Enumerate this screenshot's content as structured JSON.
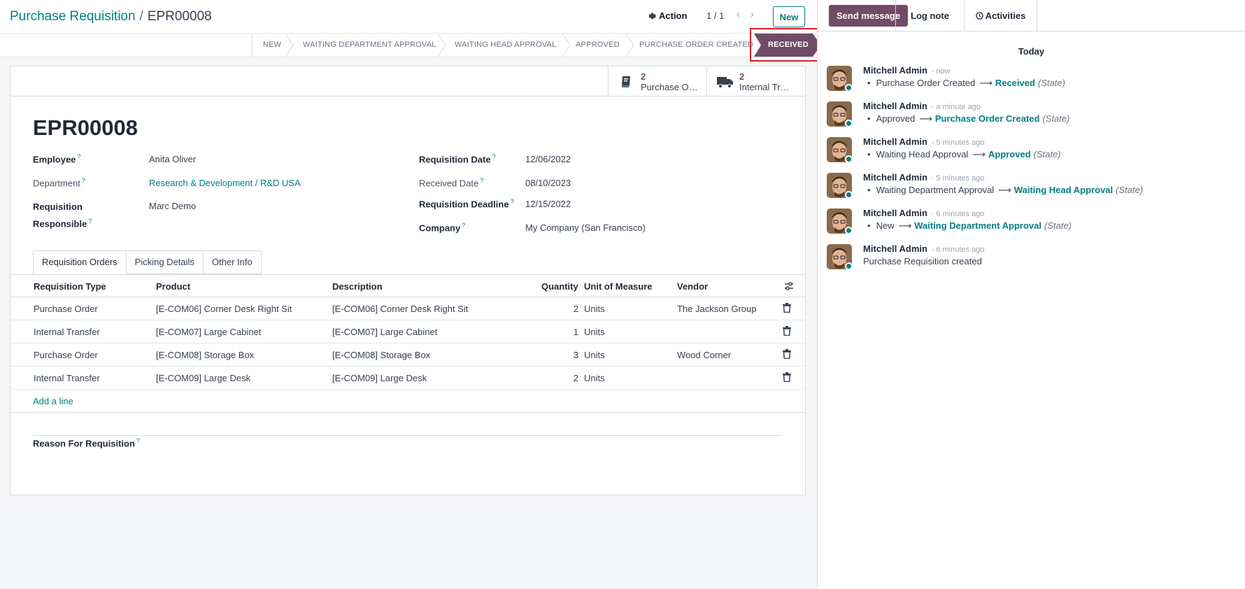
{
  "breadcrumb": {
    "parent": "Purchase Requisition",
    "current": "EPR00008"
  },
  "control": {
    "action_label": "Action",
    "pager": "1 / 1",
    "new_label": "New"
  },
  "statusbar": {
    "steps": [
      "NEW",
      "WAITING DEPARTMENT APPROVAL",
      "WAITING HEAD APPROVAL",
      "APPROVED",
      "PURCHASE ORDER CREATED",
      "RECEIVED"
    ],
    "active": "RECEIVED"
  },
  "smart_buttons": [
    {
      "count": "2",
      "label": "Purchase O…",
      "icon": "book-icon"
    },
    {
      "count": "2",
      "label": "Internal Tr…",
      "icon": "truck-icon"
    }
  ],
  "record": {
    "title": "EPR00008",
    "employee_label": "Employee",
    "employee": "Anita Oliver",
    "department_label": "Department",
    "department": "Research & Development / R&D USA",
    "responsible_label_1": "Requisition",
    "responsible_label_2": "Responsible",
    "responsible": "Marc Demo",
    "req_date_label": "Requisition Date",
    "req_date": "12/06/2022",
    "received_date_label": "Received Date",
    "received_date": "08/10/2023",
    "deadline_label": "Requisition Deadline",
    "deadline": "12/15/2022",
    "company_label": "Company",
    "company": "My Company (San Francisco)",
    "help_mark": "?"
  },
  "tabs": [
    "Requisition Orders",
    "Picking Details",
    "Other Info"
  ],
  "table": {
    "headers": [
      "Requisition Type",
      "Product",
      "Description",
      "Quantity",
      "Unit of Measure",
      "Vendor"
    ],
    "rows": [
      {
        "type": "Purchase Order",
        "product": "[E-COM06] Corner Desk Right Sit",
        "description": "[E-COM06] Corner Desk Right Sit",
        "qty": "2",
        "uom": "Units",
        "vendor": "The Jackson Group"
      },
      {
        "type": "Internal Transfer",
        "product": "[E-COM07] Large Cabinet",
        "description": "[E-COM07] Large Cabinet",
        "qty": "1",
        "uom": "Units",
        "vendor": ""
      },
      {
        "type": "Purchase Order",
        "product": "[E-COM08] Storage Box",
        "description": "[E-COM08] Storage Box",
        "qty": "3",
        "uom": "Units",
        "vendor": "Wood Corner"
      },
      {
        "type": "Internal Transfer",
        "product": "[E-COM09] Large Desk",
        "description": "[E-COM09] Large Desk",
        "qty": "2",
        "uom": "Units",
        "vendor": ""
      }
    ],
    "add_line": "Add a line"
  },
  "reason_label": "Reason For Requisition",
  "chatter": {
    "send_message": "Send message",
    "log_note": "Log note",
    "activities": "Activities",
    "today": "Today",
    "messages": [
      {
        "author": "Mitchell Admin",
        "time": "- now",
        "old": "Purchase Order Created",
        "new": "Received",
        "field": "(State)"
      },
      {
        "author": "Mitchell Admin",
        "time": "- a minute ago",
        "old": "Approved",
        "new": "Purchase Order Created",
        "field": "(State)"
      },
      {
        "author": "Mitchell Admin",
        "time": "- 5 minutes ago",
        "old": "Waiting Head Approval",
        "new": "Approved",
        "field": "(State)"
      },
      {
        "author": "Mitchell Admin",
        "time": "- 5 minutes ago",
        "old": "Waiting Department Approval",
        "new": "Waiting Head Approval",
        "field": "(State)"
      },
      {
        "author": "Mitchell Admin",
        "time": "- 6 minutes ago",
        "old": "New",
        "new": "Waiting Department Approval",
        "field": "(State)"
      }
    ],
    "created": {
      "author": "Mitchell Admin",
      "time": "- 6 minutes ago",
      "body": "Purchase Requisition created"
    }
  },
  "colors": {
    "primary": "#714b67",
    "link": "#017e84",
    "highlight": "#d61f26"
  }
}
